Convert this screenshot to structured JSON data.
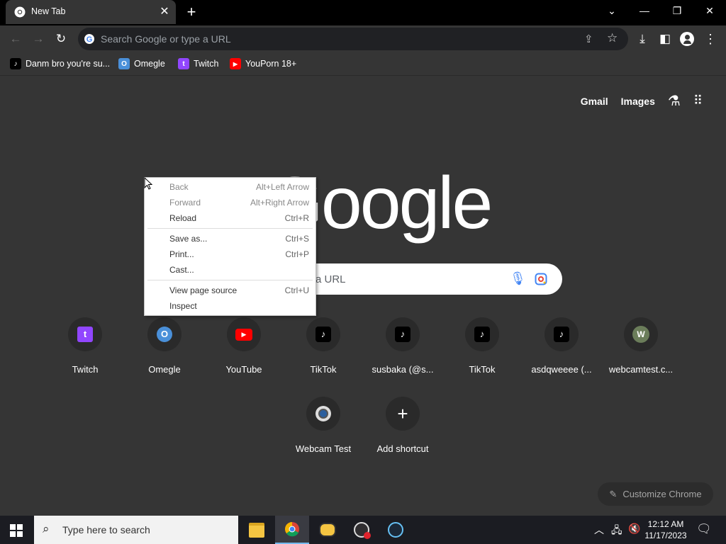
{
  "browser": {
    "tab_title": "New Tab",
    "omnibox_placeholder": "Search Google or type a URL"
  },
  "bookmarks": [
    {
      "label": "Danm bro you're su...",
      "icon": "tiktok-icon"
    },
    {
      "label": "Omegle",
      "icon": "omegle-icon"
    },
    {
      "label": "Twitch",
      "icon": "twitch-icon"
    },
    {
      "label": "YouPorn 18+",
      "icon": "youtube-icon"
    }
  ],
  "page": {
    "top_links": {
      "gmail": "Gmail",
      "images": "Images"
    },
    "logo": "Google",
    "search_placeholder_visible": "a URL",
    "shortcuts": [
      {
        "label": "Twitch",
        "icon": "twitch-icon"
      },
      {
        "label": "Omegle",
        "icon": "omegle-icon"
      },
      {
        "label": "YouTube",
        "icon": "youtube-icon"
      },
      {
        "label": "TikTok",
        "icon": "tiktok-icon"
      },
      {
        "label": "susbaka (@s...",
        "icon": "tiktok-icon"
      },
      {
        "label": "TikTok",
        "icon": "tiktok-icon"
      },
      {
        "label": "asdqweeee (...",
        "icon": "tiktok-icon"
      },
      {
        "label": "webcamtest.c...",
        "icon": "letter-w-icon",
        "letter": "W"
      },
      {
        "label": "Webcam Test",
        "icon": "webcam-icon"
      },
      {
        "label": "Add shortcut",
        "icon": "plus-icon"
      }
    ],
    "customize_label": "Customize Chrome"
  },
  "context_menu": {
    "items": [
      {
        "label": "Back",
        "shortcut": "Alt+Left Arrow",
        "disabled": true
      },
      {
        "label": "Forward",
        "shortcut": "Alt+Right Arrow",
        "disabled": true
      },
      {
        "label": "Reload",
        "shortcut": "Ctrl+R",
        "disabled": false
      },
      {
        "label": "Save as...",
        "shortcut": "Ctrl+S",
        "disabled": false
      },
      {
        "label": "Print...",
        "shortcut": "Ctrl+P",
        "disabled": false
      },
      {
        "label": "Cast...",
        "shortcut": "",
        "disabled": false
      },
      {
        "label": "View page source",
        "shortcut": "Ctrl+U",
        "disabled": false
      },
      {
        "label": "Inspect",
        "shortcut": "",
        "disabled": false
      }
    ]
  },
  "taskbar": {
    "search_placeholder": "Type here to search",
    "time": "12:12 AM",
    "date": "11/17/2023"
  },
  "colors": {
    "twitch": "#9146ff",
    "youtube": "#ff0000",
    "tiktok_bg": "#000000",
    "page_bg": "#353535"
  }
}
